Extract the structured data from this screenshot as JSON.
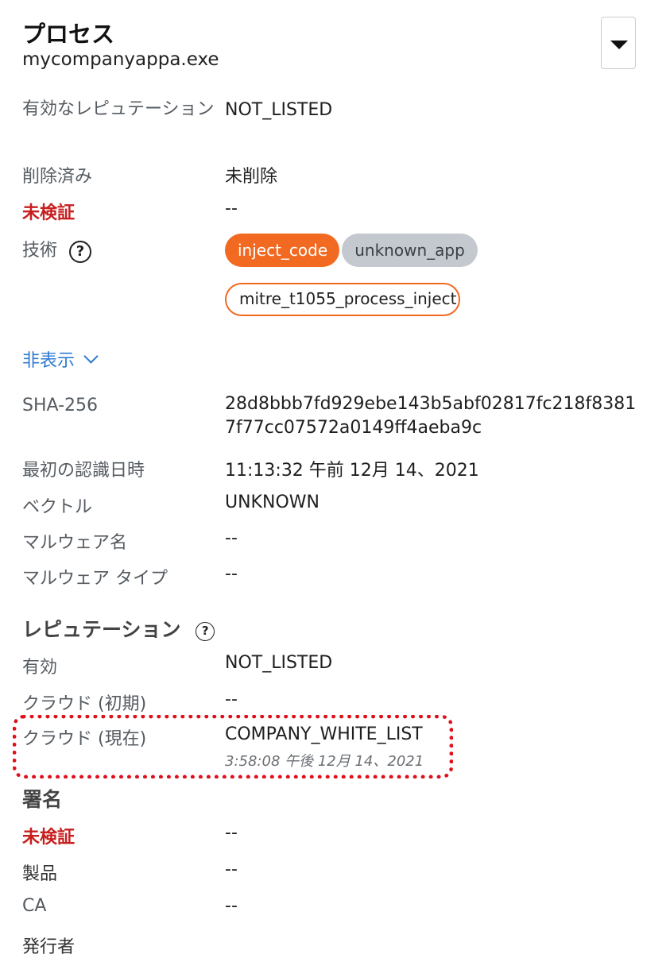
{
  "header": {
    "title": "プロセス",
    "subtitle": "mycompanyappa.exe"
  },
  "rows_top": [
    {
      "label": "有効なレピュテーション",
      "value": "NOT_LISTED"
    },
    {
      "label": "削除済み",
      "value": "未削除"
    },
    {
      "label": "未検証",
      "value": "--"
    },
    {
      "label": "技術"
    }
  ],
  "tags": {
    "tag1": "inject_code",
    "tag2": "unknown_app",
    "tag3": "mitre_t1055_process_inject"
  },
  "toggle": {
    "label": "非表示"
  },
  "details": [
    {
      "label": "SHA-256",
      "value": "28d8bbb7fd929ebe143b5abf02817fc218f83817f77cc07572a0149ff4aeba9c"
    },
    {
      "label": "最初の認識日時",
      "value": "11:13:32 午前 12月 14、2021"
    },
    {
      "label": "ベクトル",
      "value": "UNKNOWN"
    },
    {
      "label": "マルウェア名",
      "value": "--"
    },
    {
      "label": "マルウェア タイプ",
      "value": "--"
    }
  ],
  "reputation": {
    "title": "レピュテーション",
    "rows": [
      {
        "label": "有効",
        "value": "NOT_LISTED"
      },
      {
        "label": "クラウド (初期)",
        "value": "--"
      },
      {
        "label": "クラウド (現在)",
        "value": "COMPANY_WHITE_LIST",
        "timestamp": "3:58:08 午後 12月 14、2021"
      }
    ]
  },
  "signature": {
    "title": "署名",
    "rows": [
      {
        "label": "未検証",
        "value": "--"
      },
      {
        "label": "製品",
        "value": "--"
      },
      {
        "label": "CA",
        "value": "--"
      },
      {
        "label": "発行者",
        "value": ""
      }
    ]
  },
  "help_glyph": "?",
  "colors": {
    "accent_orange": "#f26a22",
    "tag_gray": "#c3c9cf",
    "link_blue": "#2f7ad1",
    "warning_red": "#c81e1e",
    "highlight_red": "#e0101a"
  }
}
